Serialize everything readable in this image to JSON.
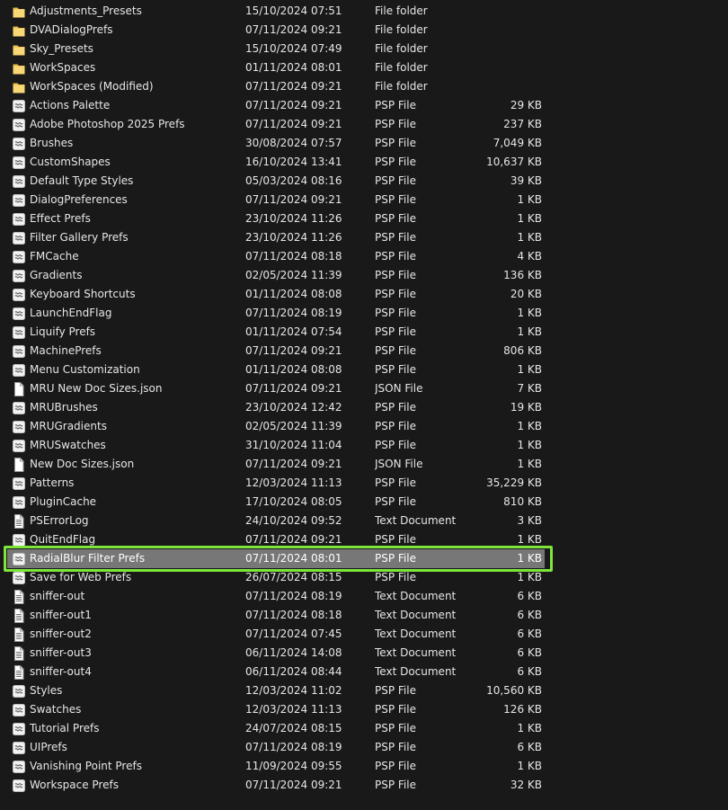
{
  "files": [
    {
      "name": "Adjustments_Presets",
      "date": "15/10/2024 07:51",
      "type": "File folder",
      "size": "",
      "icon": "folder-icon"
    },
    {
      "name": "DVADialogPrefs",
      "date": "07/11/2024 09:21",
      "type": "File folder",
      "size": "",
      "icon": "folder-icon"
    },
    {
      "name": "Sky_Presets",
      "date": "15/10/2024 07:49",
      "type": "File folder",
      "size": "",
      "icon": "folder-icon"
    },
    {
      "name": "WorkSpaces",
      "date": "01/11/2024 08:01",
      "type": "File folder",
      "size": "",
      "icon": "folder-icon"
    },
    {
      "name": "WorkSpaces (Modified)",
      "date": "07/11/2024 09:21",
      "type": "File folder",
      "size": "",
      "icon": "folder-icon"
    },
    {
      "name": "Actions Palette",
      "date": "07/11/2024 09:21",
      "type": "PSP File",
      "size": "29 KB",
      "icon": "psp-file-icon"
    },
    {
      "name": "Adobe Photoshop 2025 Prefs",
      "date": "07/11/2024 09:21",
      "type": "PSP File",
      "size": "237 KB",
      "icon": "psp-file-icon"
    },
    {
      "name": "Brushes",
      "date": "30/08/2024 07:57",
      "type": "PSP File",
      "size": "7,049 KB",
      "icon": "psp-file-icon"
    },
    {
      "name": "CustomShapes",
      "date": "16/10/2024 13:41",
      "type": "PSP File",
      "size": "10,637 KB",
      "icon": "psp-file-icon"
    },
    {
      "name": "Default Type Styles",
      "date": "05/03/2024 08:16",
      "type": "PSP File",
      "size": "39 KB",
      "icon": "psp-file-icon"
    },
    {
      "name": "DialogPreferences",
      "date": "07/11/2024 09:21",
      "type": "PSP File",
      "size": "1 KB",
      "icon": "psp-file-icon"
    },
    {
      "name": "Effect Prefs",
      "date": "23/10/2024 11:26",
      "type": "PSP File",
      "size": "1 KB",
      "icon": "psp-file-icon"
    },
    {
      "name": "Filter Gallery Prefs",
      "date": "23/10/2024 11:26",
      "type": "PSP File",
      "size": "1 KB",
      "icon": "psp-file-icon"
    },
    {
      "name": "FMCache",
      "date": "07/11/2024 08:18",
      "type": "PSP File",
      "size": "4 KB",
      "icon": "psp-file-icon"
    },
    {
      "name": "Gradients",
      "date": "02/05/2024 11:39",
      "type": "PSP File",
      "size": "136 KB",
      "icon": "psp-file-icon"
    },
    {
      "name": "Keyboard Shortcuts",
      "date": "01/11/2024 08:08",
      "type": "PSP File",
      "size": "20 KB",
      "icon": "psp-file-icon"
    },
    {
      "name": "LaunchEndFlag",
      "date": "07/11/2024 08:19",
      "type": "PSP File",
      "size": "1 KB",
      "icon": "psp-file-icon"
    },
    {
      "name": "Liquify Prefs",
      "date": "01/11/2024 07:54",
      "type": "PSP File",
      "size": "1 KB",
      "icon": "psp-file-icon"
    },
    {
      "name": "MachinePrefs",
      "date": "07/11/2024 09:21",
      "type": "PSP File",
      "size": "806 KB",
      "icon": "psp-file-icon"
    },
    {
      "name": "Menu Customization",
      "date": "01/11/2024 08:08",
      "type": "PSP File",
      "size": "1 KB",
      "icon": "psp-file-icon"
    },
    {
      "name": "MRU New Doc Sizes.json",
      "date": "07/11/2024 09:21",
      "type": "JSON File",
      "size": "7 KB",
      "icon": "blank-file-icon"
    },
    {
      "name": "MRUBrushes",
      "date": "23/10/2024 12:42",
      "type": "PSP File",
      "size": "19 KB",
      "icon": "psp-file-icon"
    },
    {
      "name": "MRUGradients",
      "date": "02/05/2024 11:39",
      "type": "PSP File",
      "size": "1 KB",
      "icon": "psp-file-icon"
    },
    {
      "name": "MRUSwatches",
      "date": "31/10/2024 11:04",
      "type": "PSP File",
      "size": "1 KB",
      "icon": "psp-file-icon"
    },
    {
      "name": "New Doc Sizes.json",
      "date": "07/11/2024 09:21",
      "type": "JSON File",
      "size": "1 KB",
      "icon": "blank-file-icon"
    },
    {
      "name": "Patterns",
      "date": "12/03/2024 11:13",
      "type": "PSP File",
      "size": "35,229 KB",
      "icon": "psp-file-icon"
    },
    {
      "name": "PluginCache",
      "date": "17/10/2024 08:05",
      "type": "PSP File",
      "size": "810 KB",
      "icon": "psp-file-icon"
    },
    {
      "name": "PSErrorLog",
      "date": "24/10/2024 09:52",
      "type": "Text Document",
      "size": "3 KB",
      "icon": "text-file-icon"
    },
    {
      "name": "QuitEndFlag",
      "date": "07/11/2024 09:21",
      "type": "PSP File",
      "size": "1 KB",
      "icon": "psp-file-icon"
    },
    {
      "name": "RadialBlur Filter Prefs",
      "date": "07/11/2024 08:01",
      "type": "PSP File",
      "size": "1 KB",
      "icon": "psp-file-icon",
      "selected": true
    },
    {
      "name": "Save for Web Prefs",
      "date": "26/07/2024 08:15",
      "type": "PSP File",
      "size": "1 KB",
      "icon": "psp-file-icon"
    },
    {
      "name": "sniffer-out",
      "date": "07/11/2024 08:19",
      "type": "Text Document",
      "size": "6 KB",
      "icon": "text-file-icon"
    },
    {
      "name": "sniffer-out1",
      "date": "07/11/2024 08:18",
      "type": "Text Document",
      "size": "6 KB",
      "icon": "text-file-icon"
    },
    {
      "name": "sniffer-out2",
      "date": "07/11/2024 07:45",
      "type": "Text Document",
      "size": "6 KB",
      "icon": "text-file-icon"
    },
    {
      "name": "sniffer-out3",
      "date": "06/11/2024 14:08",
      "type": "Text Document",
      "size": "6 KB",
      "icon": "text-file-icon"
    },
    {
      "name": "sniffer-out4",
      "date": "06/11/2024 08:44",
      "type": "Text Document",
      "size": "6 KB",
      "icon": "text-file-icon"
    },
    {
      "name": "Styles",
      "date": "12/03/2024 11:02",
      "type": "PSP File",
      "size": "10,560 KB",
      "icon": "psp-file-icon"
    },
    {
      "name": "Swatches",
      "date": "12/03/2024 11:13",
      "type": "PSP File",
      "size": "126 KB",
      "icon": "psp-file-icon"
    },
    {
      "name": "Tutorial Prefs",
      "date": "24/07/2024 08:15",
      "type": "PSP File",
      "size": "1 KB",
      "icon": "psp-file-icon"
    },
    {
      "name": "UIPrefs",
      "date": "07/11/2024 08:19",
      "type": "PSP File",
      "size": "6 KB",
      "icon": "psp-file-icon"
    },
    {
      "name": "Vanishing Point Prefs",
      "date": "11/09/2024 09:55",
      "type": "PSP File",
      "size": "1 KB",
      "icon": "psp-file-icon"
    },
    {
      "name": "Workspace Prefs",
      "date": "07/11/2024 09:21",
      "type": "PSP File",
      "size": "32 KB",
      "icon": "psp-file-icon"
    }
  ],
  "colors": {
    "background": "#191919",
    "text": "#e6e6e6",
    "selection": "#777777",
    "highlight_outline": "#7ee53a",
    "folder": "#f8d775"
  }
}
